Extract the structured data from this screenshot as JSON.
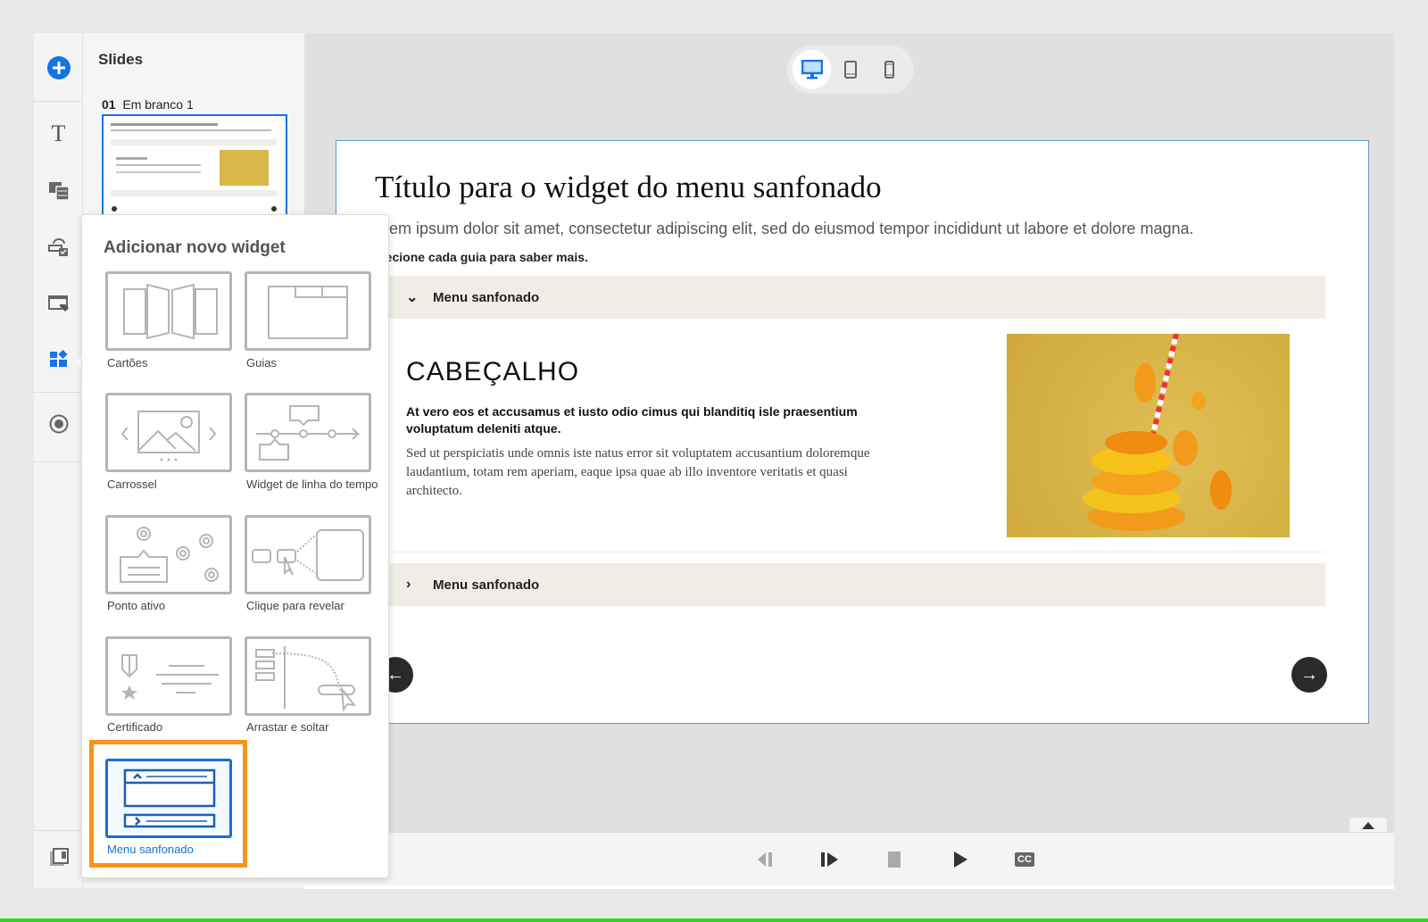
{
  "rail": {
    "items": [
      "add-icon",
      "text-icon",
      "media-icon",
      "quiz-icon",
      "interaction-icon",
      "widgets-icon",
      "record-icon",
      "slides-panel-icon"
    ]
  },
  "slides_panel": {
    "title": "Slides",
    "slide_number": "01",
    "slide_name": "Em branco 1"
  },
  "devices": [
    "desktop",
    "tablet",
    "mobile"
  ],
  "slide": {
    "title": "Título para o widget do menu sanfonado",
    "intro": "orem ipsum dolor sit amet, consectetur adipiscing elit, sed do eiusmod tempor incididunt ut labore et dolore magna.",
    "instruction": "elecione cada guia para saber mais.",
    "accordion": [
      {
        "label": "Menu sanfonado",
        "expanded": true
      },
      {
        "label": "Menu sanfonado",
        "expanded": false
      }
    ],
    "content": {
      "heading": "CABEÇALHO",
      "bold_text": "At vero eos et accusamus et iusto odio cimus qui blanditiq isle praesentium voluptatum deleniti atque.",
      "body_text": "Sed ut perspiciatis unde omnis iste natus error sit voluptatem accusantium doloremque laudantium, totam rem aperiam, eaque ipsa quae ab illo inventore veritatis et quasi architecto."
    }
  },
  "popup": {
    "title": "Adicionar novo widget",
    "widgets": [
      "Cartões",
      "Guias",
      "Carrossel",
      "Widget de linha do tempo",
      "Ponto ativo",
      "Clique para revelar",
      "Certificado",
      "Arrastar e soltar",
      "Menu sanfonado"
    ],
    "selected": "Menu sanfonado"
  },
  "playback": {
    "cc_label": "CC"
  },
  "colors": {
    "accent": "#1473e6",
    "highlight": "#f7941d",
    "accordion_bg": "#f0ede6"
  }
}
